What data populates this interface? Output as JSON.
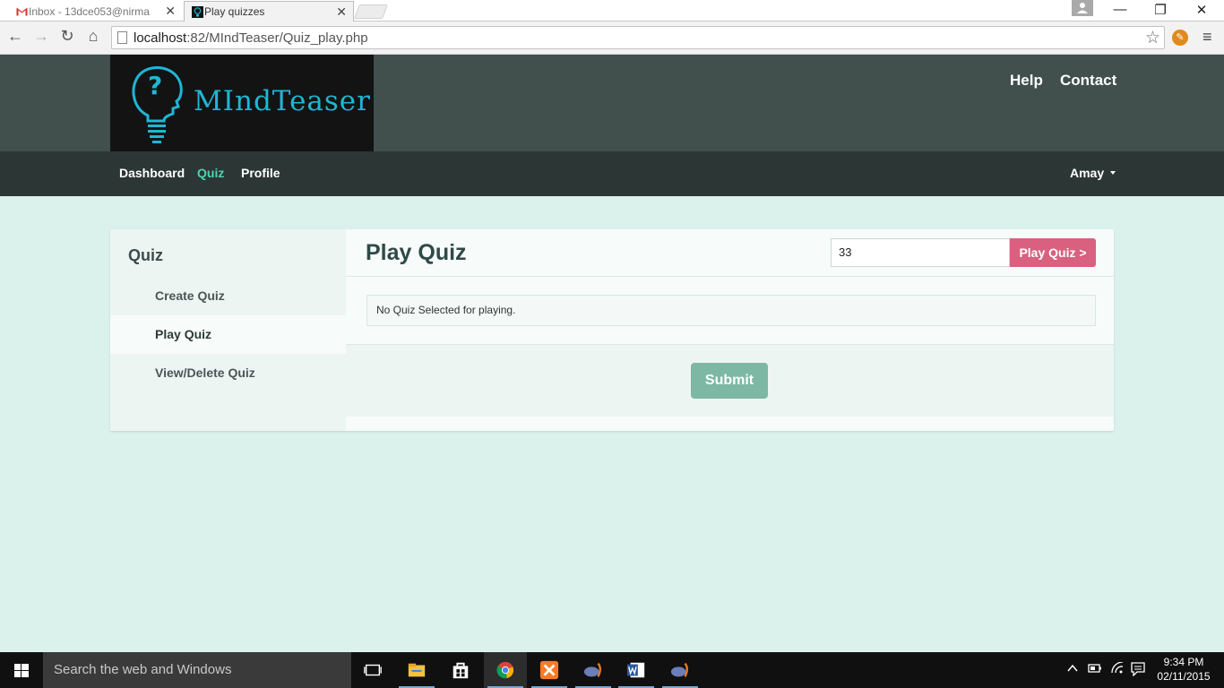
{
  "browser": {
    "tabs": [
      {
        "title": "Inbox - 13dce053@nirma",
        "active": false
      },
      {
        "title": "Play quizzes",
        "active": true
      }
    ],
    "url_host": "localhost",
    "url_path": ":82/MIndTeaser/Quiz_play.php"
  },
  "site": {
    "logo_text": "MIndTeaser",
    "header_links": [
      "Help",
      "Contact"
    ],
    "nav": {
      "items": [
        "Dashboard",
        "Quiz",
        "Profile"
      ],
      "active": "Quiz",
      "user": "Amay"
    }
  },
  "sidebar": {
    "title": "Quiz",
    "items": [
      "Create Quiz",
      "Play Quiz",
      "View/Delete Quiz"
    ],
    "active": "Play Quiz"
  },
  "main": {
    "title": "Play Quiz",
    "quiz_id_value": "33",
    "play_button": "Play Quiz >",
    "message": "No Quiz Selected for playing.",
    "submit_button": "Submit"
  },
  "taskbar": {
    "search_placeholder": "Search the web and Windows",
    "time": "9:34 PM",
    "date": "02/11/2015"
  },
  "colors": {
    "page_bg": "#dbf1ec",
    "header_bg": "#414f4d",
    "navbar_bg": "#2c3735",
    "accent": "#4fd2b0",
    "play_button": "#d9607f",
    "submit_button": "#7db8a4",
    "logo_text": "#1fb6d4"
  }
}
